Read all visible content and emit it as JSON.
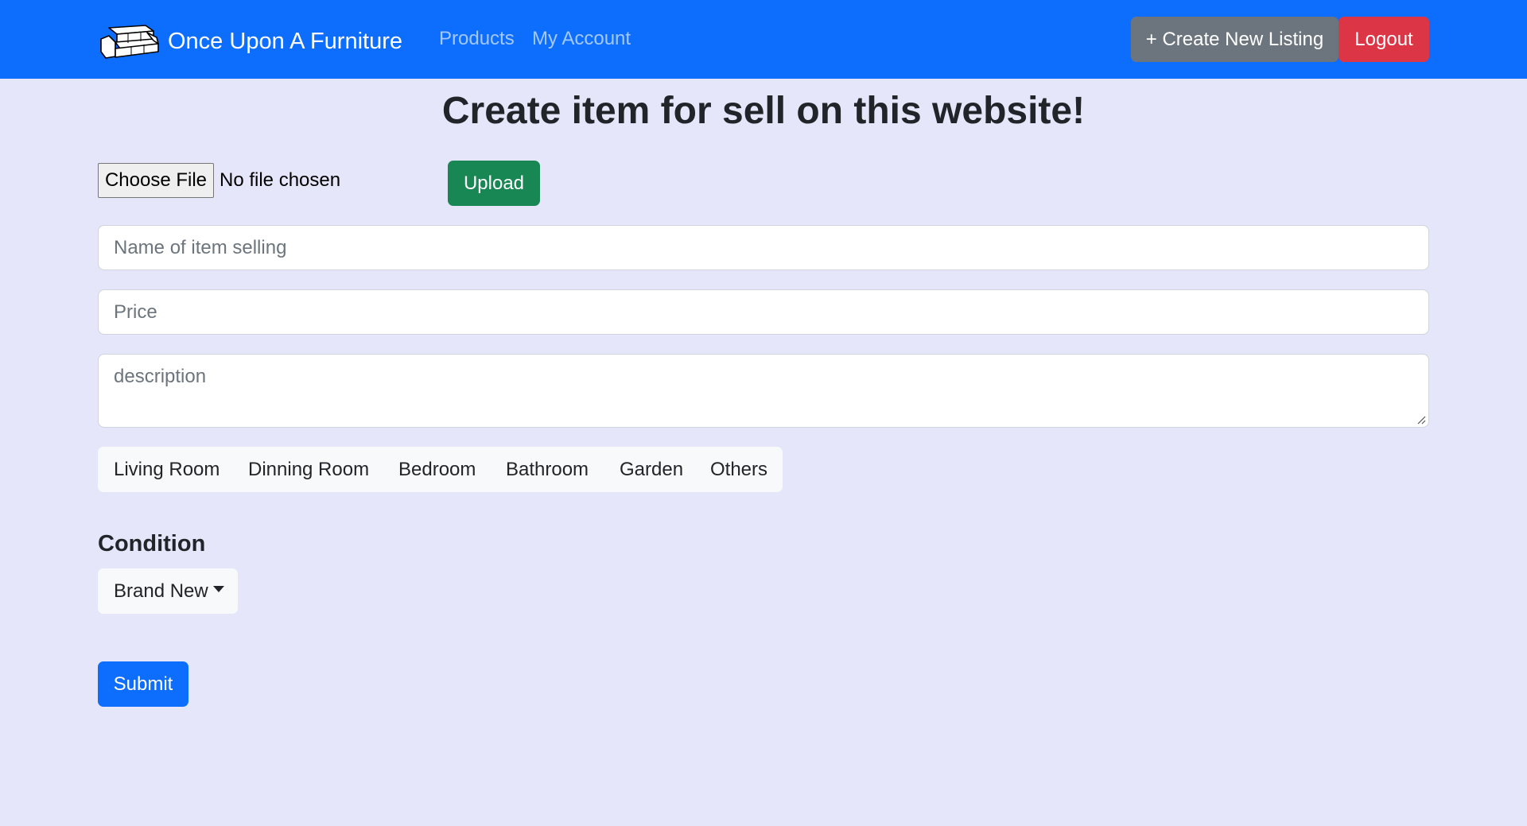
{
  "navbar": {
    "brand_title": "Once Upon A Furniture",
    "brand_icon": "sofa-icon",
    "links": [
      {
        "label": "Products"
      },
      {
        "label": "My Account"
      }
    ],
    "create_label": "+ Create New Listing",
    "logout_label": "Logout"
  },
  "page": {
    "title": "Create item for sell on this website!"
  },
  "upload": {
    "choose_label": "Choose File",
    "file_status": "No file chosen",
    "upload_label": "Upload"
  },
  "form": {
    "name_placeholder": "Name of item selling",
    "price_placeholder": "Price",
    "description_placeholder": "description"
  },
  "categories": [
    {
      "label": "Living Room"
    },
    {
      "label": "Dinning Room"
    },
    {
      "label": "Bedroom"
    },
    {
      "label": "Bathroom"
    },
    {
      "label": "Garden"
    },
    {
      "label": "Others"
    }
  ],
  "condition": {
    "label": "Condition",
    "selected": "Brand New"
  },
  "submit_label": "Submit",
  "colors": {
    "primary": "#0d6efd",
    "secondary": "#6c757d",
    "danger": "#dc3545",
    "success": "#198754",
    "page_background": "#e6e6fa"
  }
}
